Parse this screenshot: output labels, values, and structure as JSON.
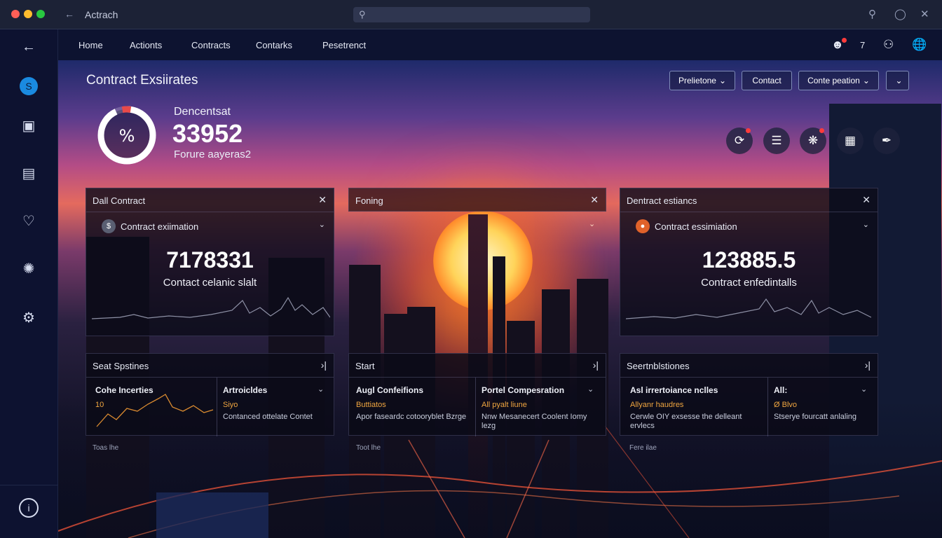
{
  "window": {
    "title": "Actrach",
    "search_placeholder": ""
  },
  "nav": {
    "items": [
      "Home",
      "Actionts",
      "Contracts",
      "Contarks",
      "Pesetrenct"
    ],
    "badge_count": "7"
  },
  "hero": {
    "title": "Contract Exsiirates",
    "metric_label": "Dencentsat",
    "metric_value": "33952",
    "metric_sub": "Forure aayeras2",
    "gauge_fraction": 0.93,
    "filters": [
      "Prelietone",
      "Contact",
      "Conte peation",
      ""
    ]
  },
  "cards": [
    {
      "title": "Dall Contract",
      "sub_label": "Contract exiimation",
      "value": "7178331",
      "caption": "Contact celanic slalt"
    },
    {
      "title": "Foning"
    },
    {
      "title": "Dentract estiancs",
      "sub_label": "Contract essimiation",
      "value": "123885.5",
      "caption": "Contract enfedintalls"
    }
  ],
  "lower": [
    {
      "title": "Seat Spstines",
      "footer": "Toas lhe",
      "cols": [
        {
          "title": "Cohe Incerties",
          "accent": "10",
          "desc": ""
        },
        {
          "title": "Artroicldes",
          "accent": "Siyo",
          "desc": "Contanced ottelate Contet"
        }
      ]
    },
    {
      "title": "Start",
      "footer": "Toot lhe",
      "cols": [
        {
          "title": "Augl Confeifions",
          "accent": "Buttiatos",
          "desc": "Apor faseardc cotooryblet Bzrge"
        },
        {
          "title": "Portel Compesration",
          "accent": "All pyalt liune",
          "desc": "Nnw Mesanecert Coolent Iomy lezg"
        }
      ]
    },
    {
      "title": "Seertnblstiones",
      "footer": "Fere ilae",
      "cols": [
        {
          "title": "Asl irrertoiance nclles",
          "accent": "Allyanr haudres",
          "desc": "Cerwle OIY exsesse the delleant ervlecs"
        },
        {
          "title": "All:",
          "accent": "Ø Blvo",
          "desc": "Stserye fourcatt anlaling"
        }
      ]
    }
  ],
  "colors": {
    "accent": "#f0a640",
    "notification": "#ff3b3b",
    "gauge": "#ffffff",
    "gauge_alert": "#e84a4a"
  },
  "icons": [
    "back-arrow-icon",
    "search-icon",
    "user-avatar-icon",
    "document-settings-icon",
    "briefcase-icon",
    "chat-icon",
    "network-icon",
    "settings-icon",
    "info-icon",
    "people-icon",
    "user-icon",
    "globe-icon"
  ]
}
